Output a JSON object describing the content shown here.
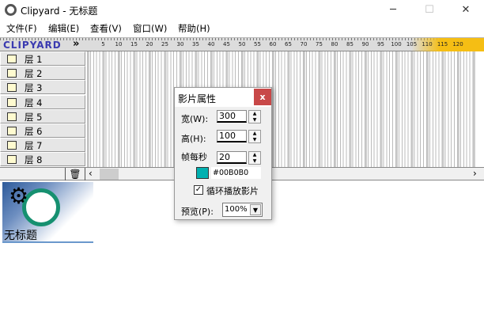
{
  "window": {
    "title": "Clipyard - 无标题",
    "minimize": "─",
    "maximize": "☐",
    "close": "✕"
  },
  "menu": [
    "文件(F)",
    "编辑(E)",
    "查看(V)",
    "窗口(W)",
    "帮助(H)"
  ],
  "ruler": {
    "logo": "CLIPYARD",
    "arrows": "»",
    "labels": [
      "5",
      "10",
      "15",
      "20",
      "25",
      "30",
      "35",
      "40",
      "45",
      "50",
      "55",
      "60",
      "65",
      "70",
      "75",
      "80",
      "85",
      "90",
      "95",
      "100",
      "105",
      "110",
      "115",
      "120"
    ]
  },
  "layers": [
    "层 1",
    "层 2",
    "层 3",
    "层 4",
    "层 5",
    "层 6",
    "层 7",
    "层 8"
  ],
  "scroll": {
    "left": "‹",
    "right": "›",
    "trash": "🗑"
  },
  "movie": {
    "name": "无标题"
  },
  "dialog": {
    "title": "影片属性",
    "close": "x",
    "width_label": "宽(W):",
    "width": "300",
    "height_label": "高(H):",
    "height": "100",
    "fps_label": "帧每秒",
    "fps": "20",
    "color": "#00B0B0",
    "color_text": "#00B0B0",
    "loop_label": "循环播放影片",
    "loop_checked": true,
    "preview_label": "预览(P):",
    "preview": "100%"
  }
}
